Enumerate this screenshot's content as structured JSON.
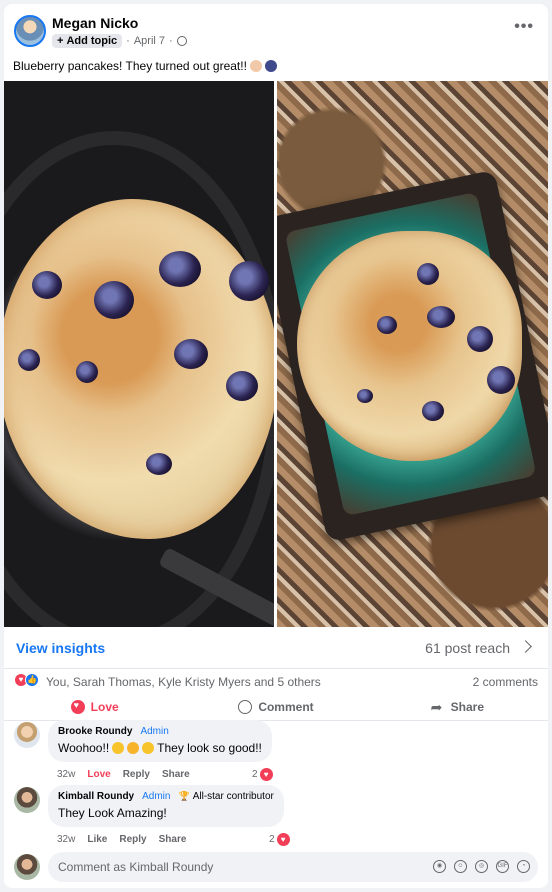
{
  "post": {
    "author": "Megan Nicko",
    "add_topic": "Add topic",
    "date": "April 7",
    "caption": "Blueberry pancakes!  They turned out great!!"
  },
  "insights": {
    "view_label": "View insights",
    "reach": "61 post reach"
  },
  "reactions": {
    "names": "You, Sarah Thomas, Kyle Kristy Myers and 5 others",
    "comments_count": "2 comments"
  },
  "actions": {
    "love": "Love",
    "comment": "Comment",
    "share": "Share"
  },
  "comments": [
    {
      "name": "Brooke Roundy",
      "badge": "Admin",
      "text_before": "Woohoo!!",
      "text_after": "They look so good!!",
      "time": "32w",
      "like": "Love",
      "reply": "Reply",
      "share": "Share",
      "reaction_count": "2"
    },
    {
      "name": "Kimball Roundy",
      "badge": "Admin",
      "extra_badge": "All-star contributor",
      "text": "They Look Amazing!",
      "time": "32w",
      "like": "Like",
      "reply": "Reply",
      "share": "Share",
      "reaction_count": "2"
    }
  ],
  "composer": {
    "placeholder": "Comment as Kimball Roundy"
  },
  "colors": {
    "accent": "#1877f2",
    "love": "#f33e58",
    "muted": "#65676b"
  }
}
